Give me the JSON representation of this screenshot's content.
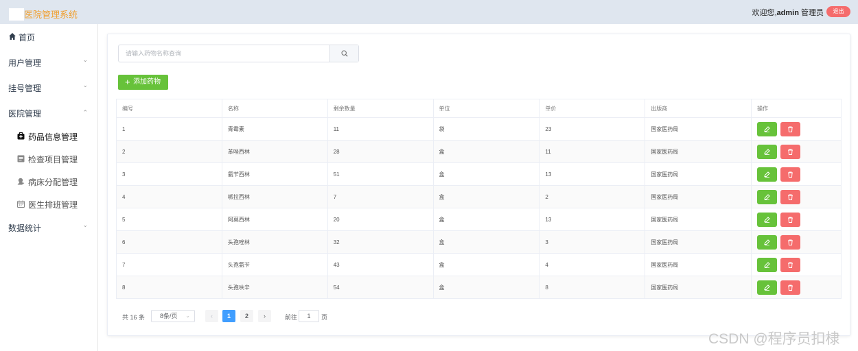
{
  "header": {
    "app_title": "医院管理系统",
    "welcome_prefix": "欢迎您,",
    "username": "admin",
    "role": "管理员",
    "logout_label": "退出"
  },
  "sidebar": {
    "home": "首页",
    "groups": [
      {
        "label": "用户管理"
      },
      {
        "label": "挂号管理"
      },
      {
        "label": "医院管理"
      },
      {
        "label": "数据统计"
      }
    ],
    "sub_items": [
      {
        "label": "药品信息管理"
      },
      {
        "label": "检查项目管理"
      },
      {
        "label": "病床分配管理"
      },
      {
        "label": "医生排班管理"
      }
    ]
  },
  "search": {
    "placeholder": "请输入药物名称查询"
  },
  "toolbar": {
    "add_label": "添加药物"
  },
  "table": {
    "columns": [
      "编号",
      "名称",
      "剩余数量",
      "单位",
      "单价",
      "出版商",
      "操作"
    ],
    "rows": [
      [
        "1",
        "青霉素",
        "11",
        "袋",
        "23",
        "国家医药局"
      ],
      [
        "2",
        "苯唑西林",
        "28",
        "盒",
        "11",
        "国家医药局"
      ],
      [
        "3",
        "氨苄西林",
        "51",
        "盒",
        "13",
        "国家医药局"
      ],
      [
        "4",
        "哌拉西林",
        "7",
        "盒",
        "2",
        "国家医药局"
      ],
      [
        "5",
        "阿莫西林",
        "20",
        "盒",
        "13",
        "国家医药局"
      ],
      [
        "6",
        "头孢唑林",
        "32",
        "盒",
        "3",
        "国家医药局"
      ],
      [
        "7",
        "头孢氨苄",
        "43",
        "盒",
        "4",
        "国家医药局"
      ],
      [
        "8",
        "头孢呋辛",
        "54",
        "盒",
        "8",
        "国家医药局"
      ]
    ]
  },
  "pagination": {
    "total_text": "共 16 条",
    "page_size": "8条/页",
    "pages": [
      "1",
      "2"
    ],
    "current_page": "1",
    "goto_label": "前往",
    "goto_value": "1",
    "goto_unit": "页"
  },
  "watermark": "CSDN @程序员扣棣",
  "colors": {
    "accent": "#409eff",
    "success": "#67c23a",
    "danger": "#f56c6c",
    "title": "#f0a030"
  }
}
